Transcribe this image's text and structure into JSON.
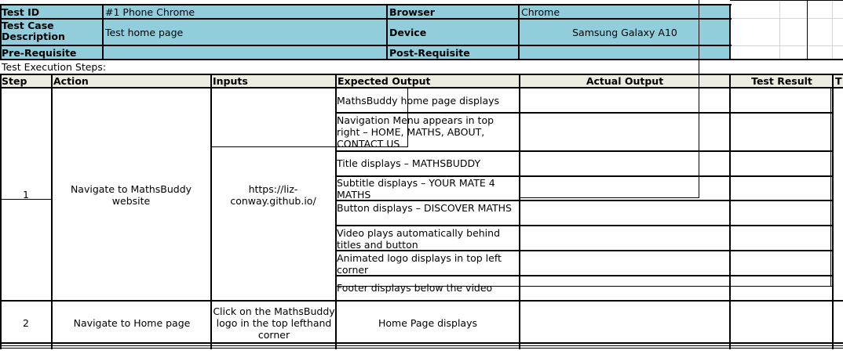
{
  "header": {
    "test_id_label": "Test  ID",
    "test_id_value": "#1 Phone Chrome",
    "browser_label": "Browser",
    "browser_value": "Chrome",
    "desc_label_line1": "Test Case",
    "desc_label_line2": "Description",
    "desc_value": "Test home page",
    "device_label": "Device",
    "device_value": "Samsung Galaxy A10",
    "prereq_label": "Pre-Requisite",
    "prereq_value": "",
    "postreq_label": "Post-Requisite",
    "postreq_value": ""
  },
  "section_title": "Test Execution Steps:",
  "columns": {
    "step": "Step",
    "action": "Action",
    "inputs": "Inputs",
    "expected": "Expected Output",
    "actual": "Actual Output",
    "result": "Test Result",
    "extra": "T"
  },
  "step1": {
    "step": "1",
    "action": "Navigate to MathsBuddy website",
    "inputs": "https://liz-conway.github.io/",
    "expected": [
      "MathsBuddy home page displays",
      "Navigation Menu appears in top right – HOME, MATHS, ABOUT, CONTACT US",
      "Title displays – MATHSBUDDY",
      "Subtitle displays – YOUR MATE 4 MATHS",
      "Button displays – DISCOVER MATHS",
      "Video plays automatically behind titles and button",
      "Animated logo displays in top left corner",
      "Footer displays below the video"
    ]
  },
  "step2": {
    "step": "2",
    "action": "Navigate to Home page",
    "inputs": "Click  on the MathsBuddy logo in the top lefthand corner",
    "expected": "Home Page displays"
  },
  "colors": {
    "header_fill": "#92cddc",
    "column_header_fill": "#eeece1",
    "gridline": "#d4d4d4"
  }
}
